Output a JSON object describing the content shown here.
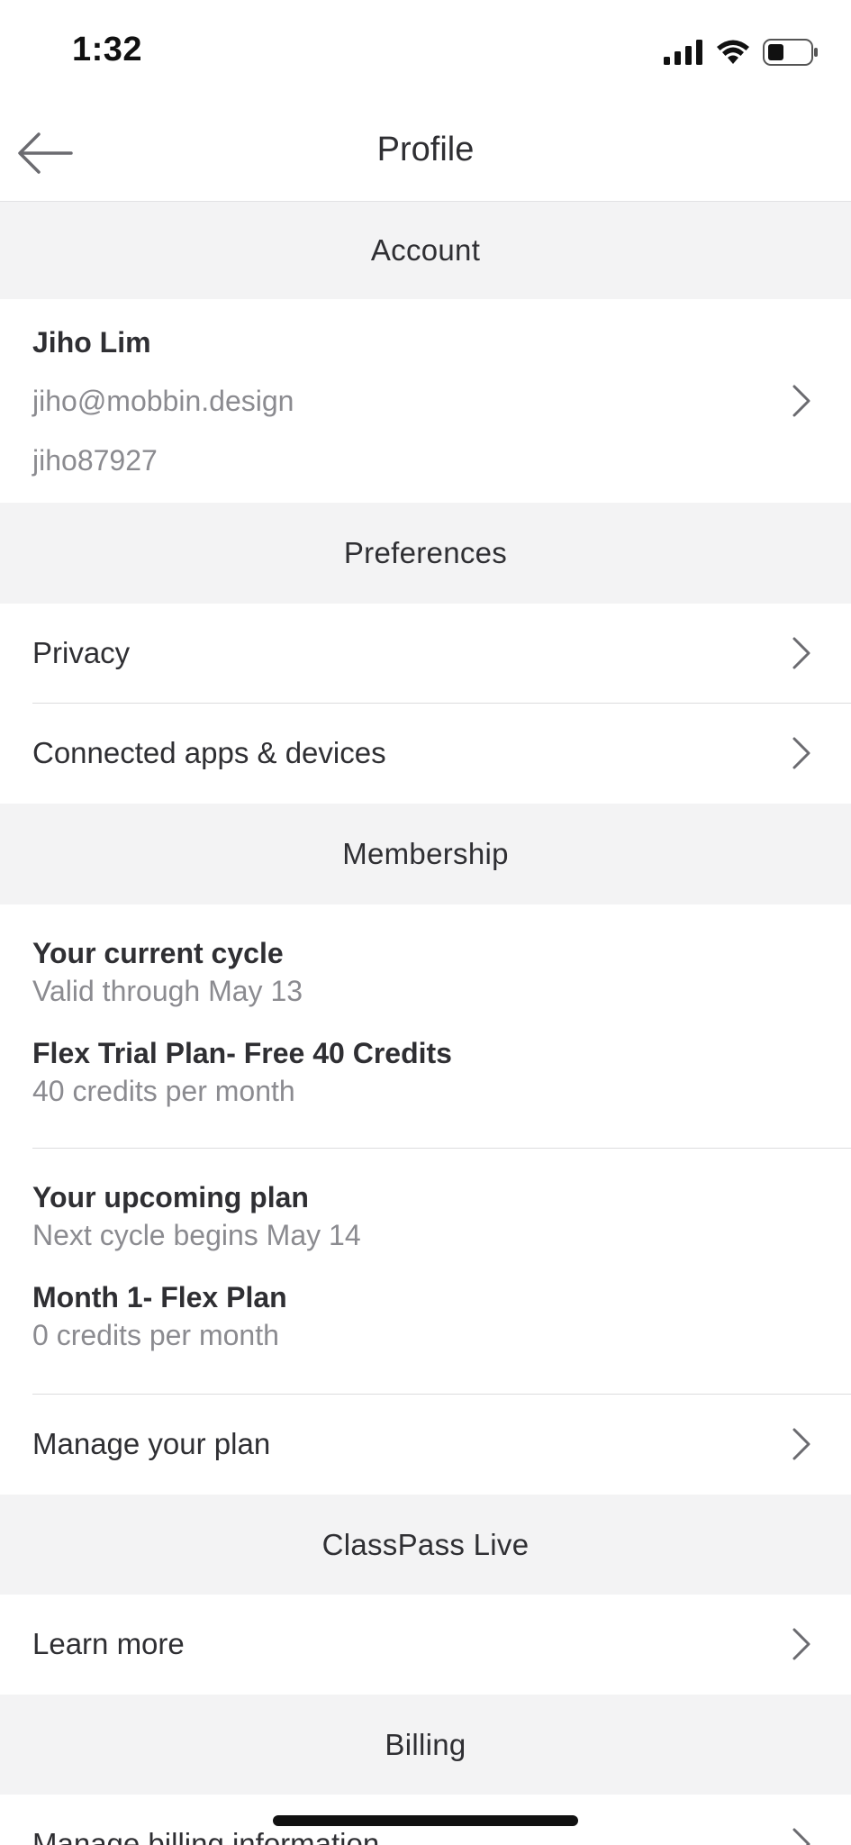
{
  "status_bar": {
    "time": "1:32"
  },
  "nav": {
    "title": "Profile"
  },
  "sections": {
    "account": "Account",
    "preferences": "Preferences",
    "membership": "Membership",
    "live": "ClassPass Live",
    "billing": "Billing"
  },
  "account": {
    "name": "Jiho Lim",
    "email": "jiho@mobbin.design",
    "username": "jiho87927"
  },
  "preferences": {
    "privacy": "Privacy",
    "connected": "Connected apps & devices"
  },
  "membership": {
    "current_title": "Your current cycle",
    "current_valid": "Valid through May 13",
    "current_plan": "Flex Trial Plan- Free 40 Credits",
    "current_credits": "40 credits per month",
    "upcoming_title": "Your upcoming plan",
    "upcoming_begins": "Next cycle begins May 14",
    "upcoming_plan": "Month 1- Flex Plan",
    "upcoming_credits": "0 credits per month",
    "manage": "Manage your plan"
  },
  "live": {
    "learn_more": "Learn more"
  },
  "billing": {
    "manage_billing": "Manage billing information"
  },
  "colors": {
    "section_bg": "#f3f3f4",
    "text": "#2f2f33",
    "muted": "#8b8b90",
    "divider": "#dcdcde"
  },
  "icons": [
    "back-arrow-icon",
    "chevron-right-icon",
    "signal-icon",
    "wifi-icon",
    "battery-icon"
  ]
}
